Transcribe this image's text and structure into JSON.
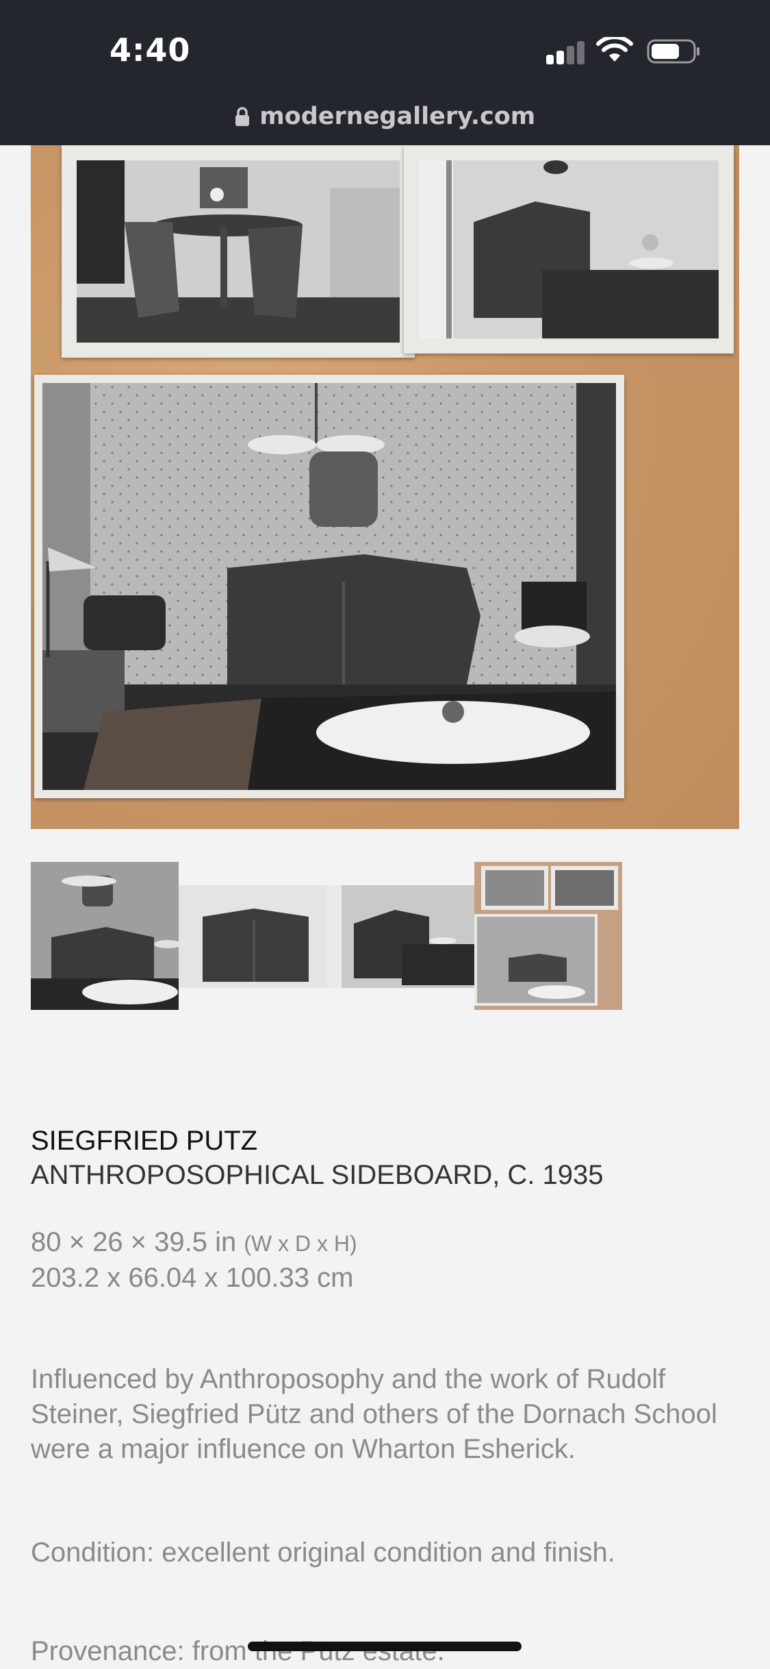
{
  "status_bar": {
    "time": "4:40"
  },
  "browser": {
    "url": "modernegallery.com"
  },
  "product": {
    "artist": "SIEGFRIED PUTZ",
    "title": "ANTHROPOSOPHICAL SIDEBOARD, C. 1935",
    "dimensions_in": "80 × 26 × 39.5 in",
    "dimensions_in_note": "(W x D x H)",
    "dimensions_cm": "203.2 x 66.04 x 100.33 cm",
    "description": "Influenced by Anthroposophy and the work of Rudolf Steiner, Siegfried Pütz and others of the Dornach School were a major influence on Wharton Esherick.",
    "condition": "Condition: excellent original condition and finish.",
    "provenance": "Provenance: from the Pütz estate."
  },
  "gallery": {
    "thumbnail_count": 4,
    "selected_index": 3
  }
}
